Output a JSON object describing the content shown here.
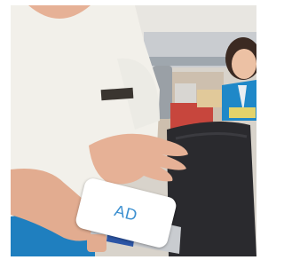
{
  "ad_overlay": {
    "label": "AD",
    "label_color": "#3b8fd0",
    "background": "#ffffff"
  },
  "scene": {
    "shirt_color": "#f2f0ea",
    "skin_color": "#e6b196",
    "uniform_blue": "#1f88c8",
    "name_badge_color": "#3a3530",
    "seat_color": "#2a2a2e",
    "cabin_wall_color": "#e9e7e1",
    "can_color": "#c9ccd0"
  }
}
